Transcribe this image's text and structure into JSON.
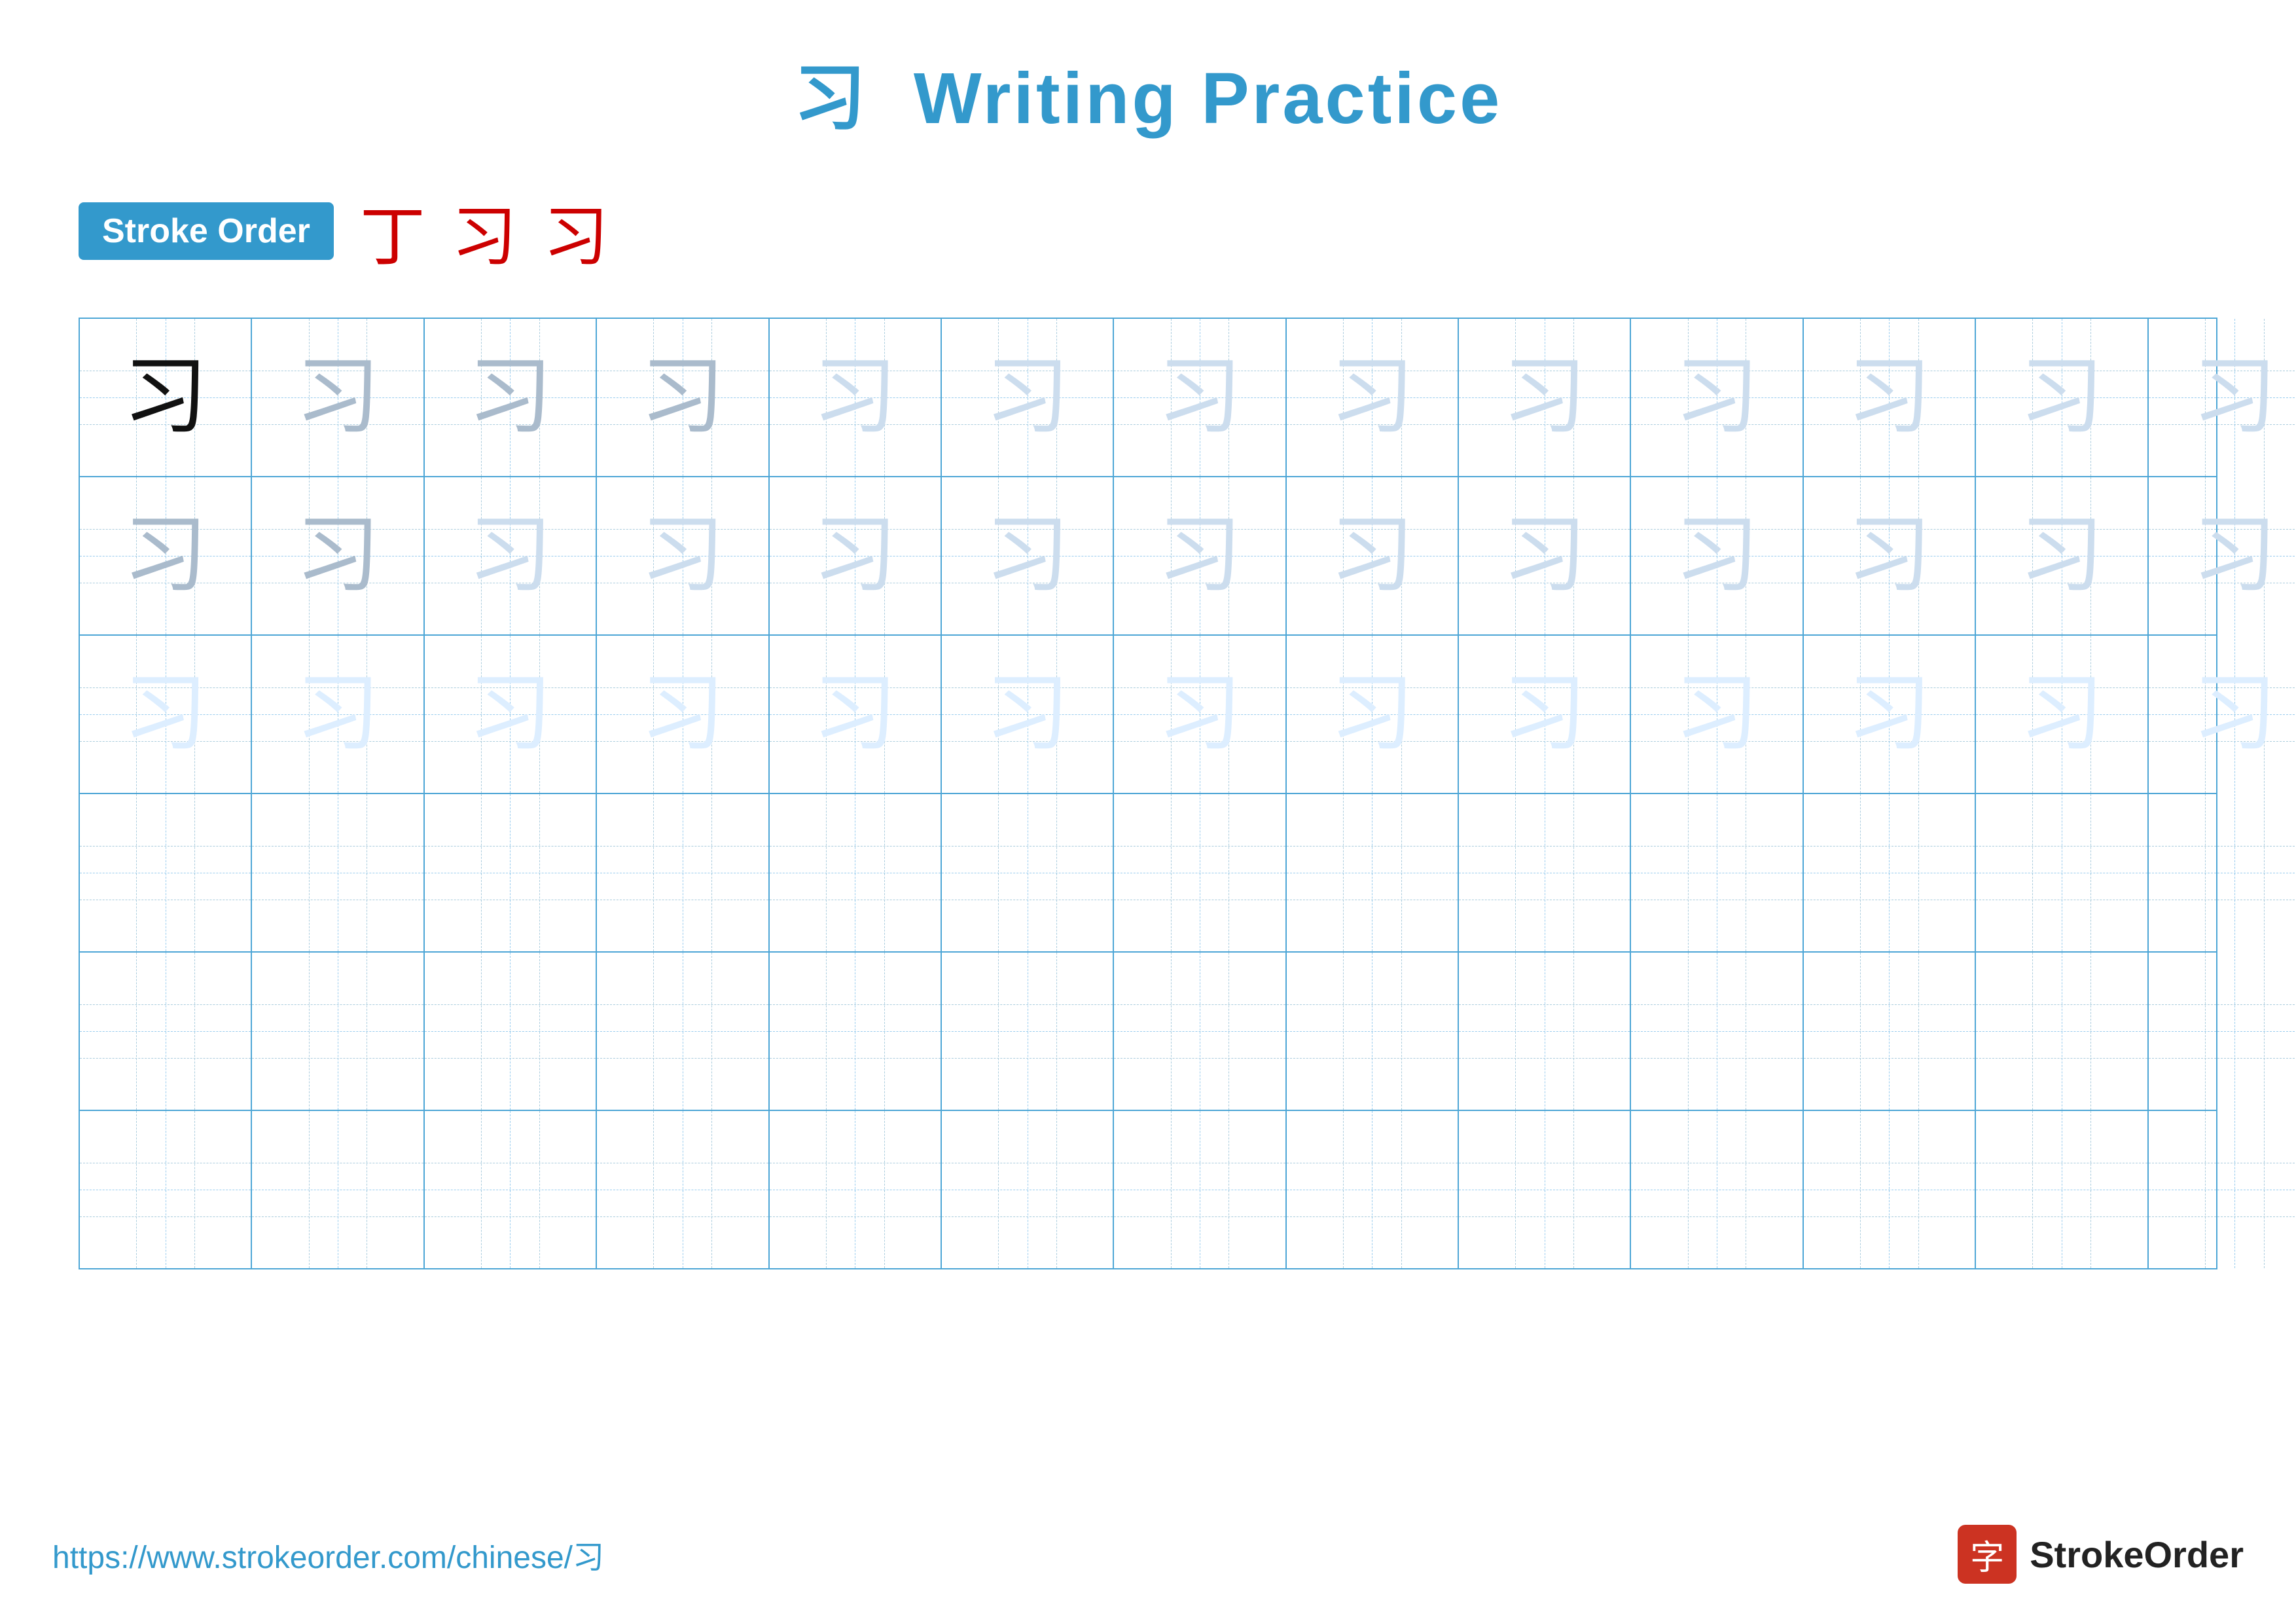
{
  "header": {
    "character": "习",
    "title": "Writing Practice"
  },
  "stroke_order": {
    "badge_label": "Stroke Order",
    "strokes": [
      "丁",
      "习",
      "习"
    ]
  },
  "grid": {
    "cols": 13,
    "rows": 6,
    "character": "习",
    "row_configs": [
      {
        "type": "dark_then_medium",
        "dark_count": 1,
        "medium_count": 3,
        "light_count": 9
      },
      {
        "type": "all_medium_light",
        "medium_count": 2,
        "light_count": 11
      },
      {
        "type": "all_light",
        "light_count": 13
      },
      {
        "type": "empty"
      },
      {
        "type": "empty"
      },
      {
        "type": "empty"
      }
    ]
  },
  "footer": {
    "url": "https://www.strokeorder.com/chinese/习",
    "brand_name": "StrokeOrder",
    "logo_char": "字"
  }
}
